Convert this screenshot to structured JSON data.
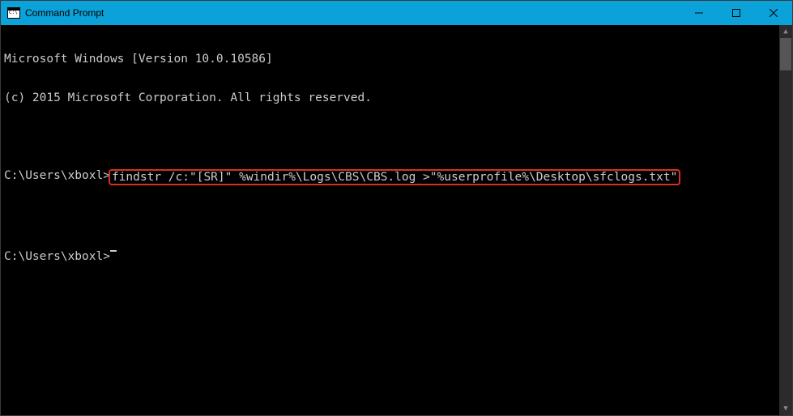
{
  "window": {
    "title": "Command Prompt"
  },
  "terminal": {
    "header_line1": "Microsoft Windows [Version 10.0.10586]",
    "header_line2": "(c) 2015 Microsoft Corporation. All rights reserved.",
    "prompt1_prefix": "C:\\Users\\xboxl>",
    "prompt1_command": "findstr /c:\"[SR]\" %windir%\\Logs\\CBS\\CBS.log >\"%userprofile%\\Desktop\\sfclogs.txt\"",
    "prompt2_prefix": "C:\\Users\\xboxl>"
  }
}
